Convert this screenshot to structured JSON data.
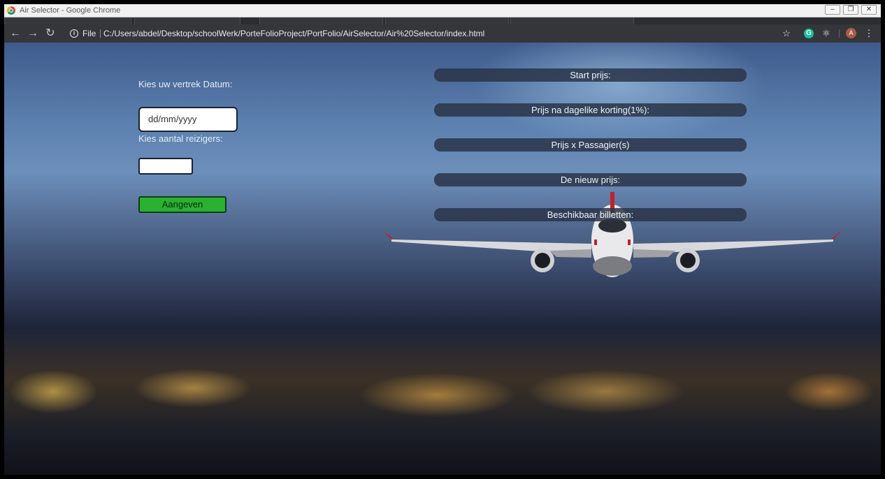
{
  "window": {
    "title": "Air Selector - Google Chrome",
    "controls": {
      "minimize": "–",
      "restore": "❐",
      "close": "✕"
    }
  },
  "toolbar": {
    "back_icon": "arrow-left-icon",
    "forward_icon": "arrow-right-icon",
    "reload_icon": "reload-icon",
    "scheme_label": "File",
    "url": "C:/Users/abdel/Desktop/schoolWerk/PorteFolioProject/PortFolio/AirSelector/Air%20Selector/index.html",
    "avatar_letter": "A",
    "grammarly_letter": "G"
  },
  "form": {
    "date_label": "Kies uw vertrek Datum:",
    "date_placeholder": "dd/mm/yyyy",
    "travelers_label": "Kies aantal reizigers:",
    "travelers_value": "",
    "submit_label": "Aangeven"
  },
  "results": {
    "start_price": "Start prijs:",
    "daily_discount_price": "Prijs na dagelike korting(1%):",
    "price_times_passengers": "Prijs x Passagier(s)",
    "new_price": "De nieuw prijs:",
    "available_tickets": "Beschikbaar billetten:"
  },
  "colors": {
    "submit_button": "#29b12f",
    "result_bar": "#2a3448",
    "toolbar": "#35363a"
  }
}
